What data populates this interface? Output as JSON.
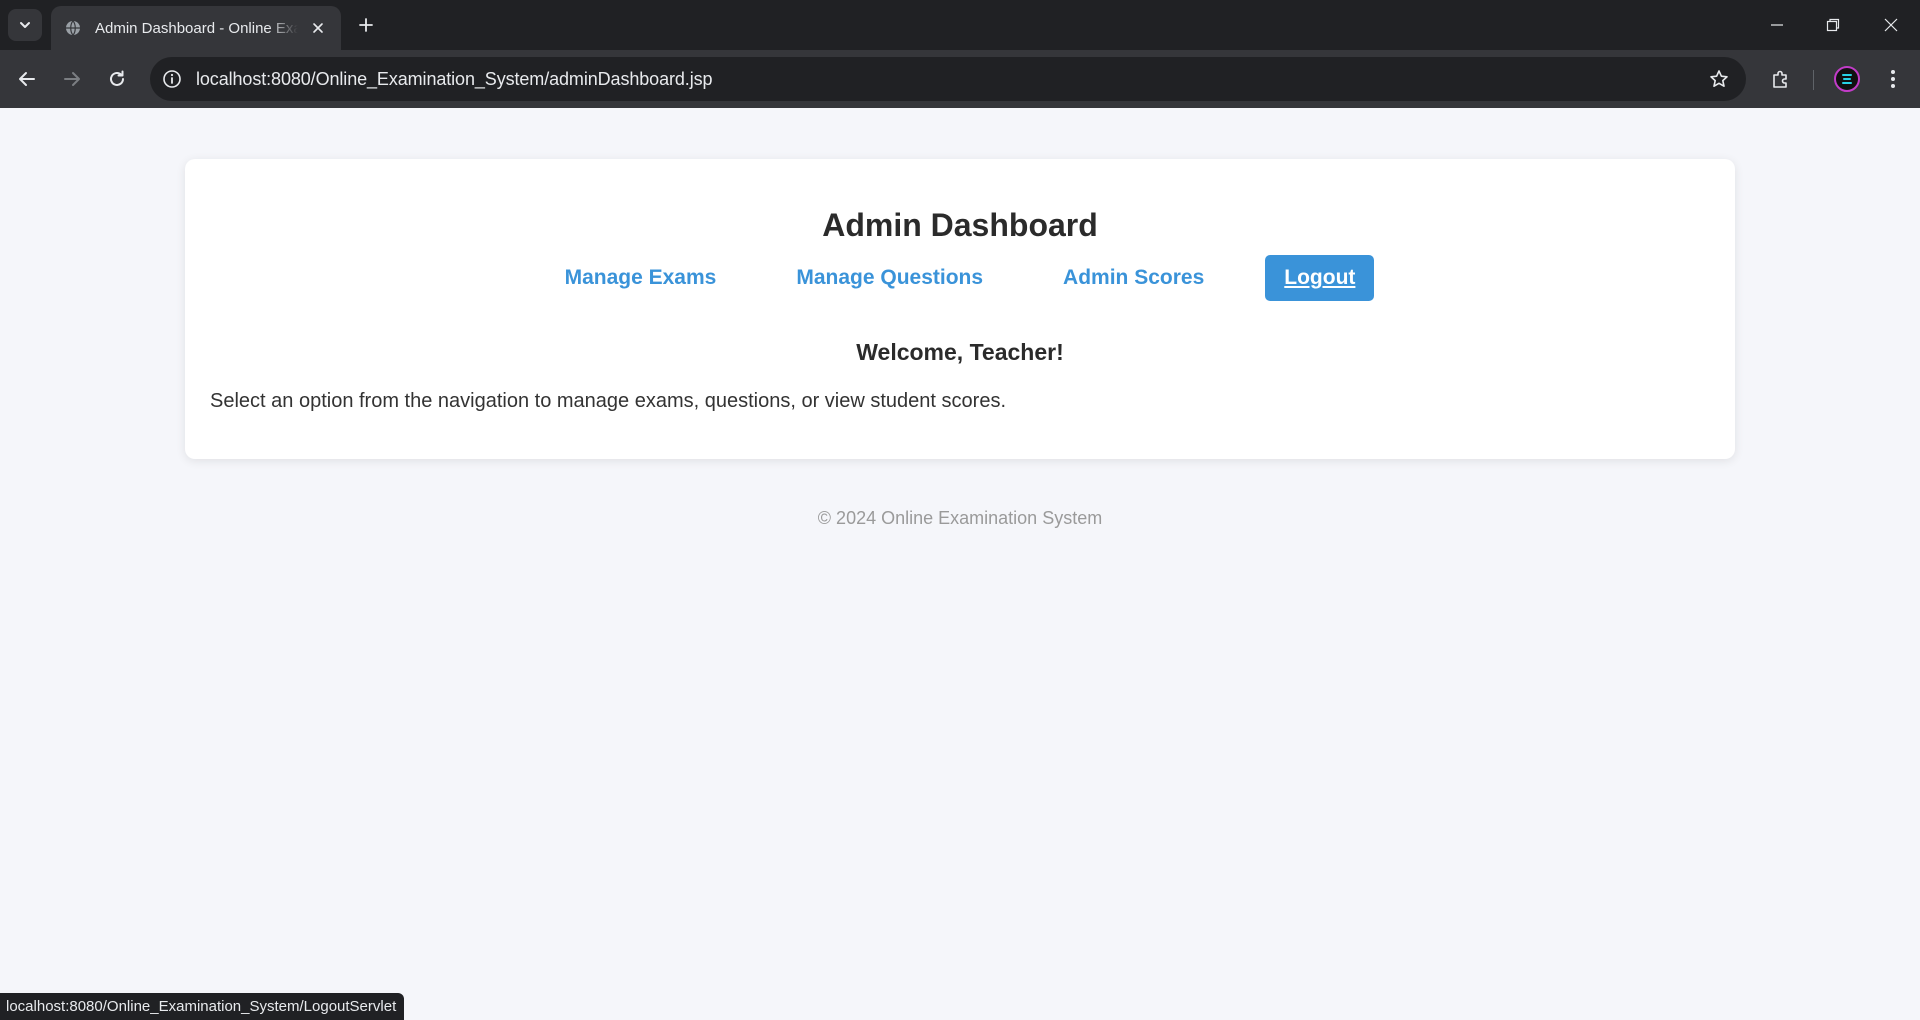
{
  "browser": {
    "tab_title": "Admin Dashboard - Online Examination System",
    "url": "localhost:8080/Online_Examination_System/adminDashboard.jsp",
    "status_url": "localhost:8080/Online_Examination_System/LogoutServlet"
  },
  "page": {
    "title": "Admin Dashboard",
    "nav": [
      {
        "label": "Manage Exams"
      },
      {
        "label": "Manage Questions"
      },
      {
        "label": "Admin Scores"
      },
      {
        "label": "Logout"
      }
    ],
    "welcome": "Welcome, Teacher!",
    "intro": "Select an option from the navigation to manage exams, questions, or view student scores.",
    "footer": "© 2024 Online Examination System"
  },
  "colors": {
    "accent": "#3a93d9",
    "page_bg": "#f5f6fa",
    "card_bg": "#ffffff"
  },
  "icons": {
    "tab_search": "chevron-down-icon",
    "favicon": "globe-icon",
    "tab_close": "close-icon",
    "new_tab": "plus-icon",
    "back": "arrow-left-icon",
    "forward": "arrow-right-icon",
    "reload": "reload-icon",
    "site_info": "info-icon",
    "bookmark": "star-icon",
    "extensions": "puzzle-icon",
    "menu": "kebab-menu-icon"
  }
}
